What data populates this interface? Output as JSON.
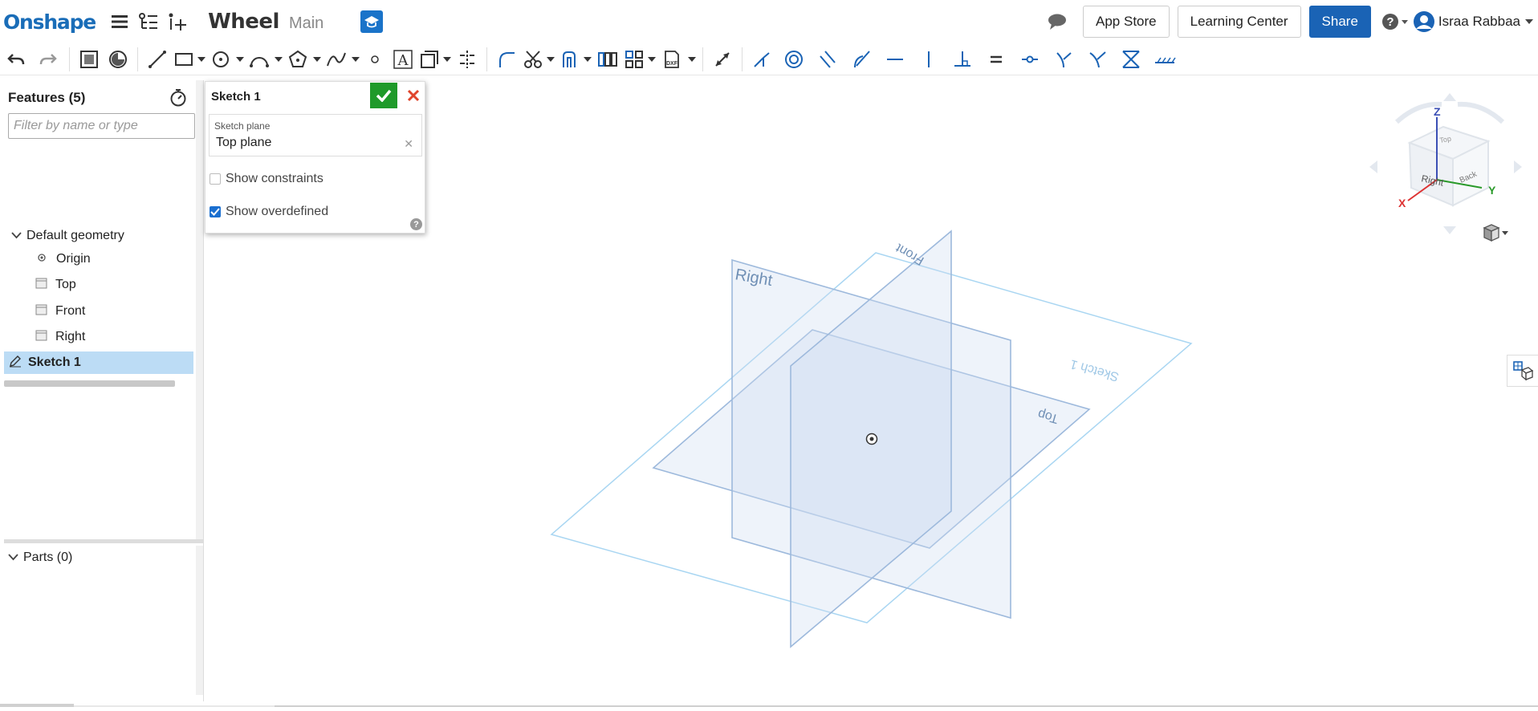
{
  "header": {
    "logo": "Onshape",
    "document_title": "Wheel",
    "branch": "Main",
    "app_store": "App Store",
    "learning_center": "Learning Center",
    "share": "Share",
    "user_name": "Israa Rabbaa"
  },
  "features_panel": {
    "title": "Features (5)",
    "filter_placeholder": "Filter by name or type",
    "default_geometry": "Default geometry",
    "items": [
      {
        "label": "Origin",
        "icon": "origin-icon"
      },
      {
        "label": "Top",
        "icon": "plane-icon"
      },
      {
        "label": "Front",
        "icon": "plane-icon"
      },
      {
        "label": "Right",
        "icon": "plane-icon"
      }
    ],
    "selected_feature": "Sketch 1",
    "parts": "Parts (0)"
  },
  "sketch_dialog": {
    "title": "Sketch 1",
    "plane_label": "Sketch plane",
    "plane_value": "Top plane",
    "show_constraints": "Show constraints",
    "show_constraints_checked": false,
    "show_overdefined": "Show overdefined",
    "show_overdefined_checked": true
  },
  "viewport": {
    "plane_labels": {
      "right": "Right",
      "front": "Front",
      "top": "Top",
      "sketch": "Sketch 1"
    },
    "view_cube": {
      "z": "Z",
      "x": "X",
      "y": "Y",
      "right": "Right",
      "back": "Back",
      "top": "Top"
    },
    "plane_color": "#8fb3d9",
    "sketch_plane_color": "#9fd0ef"
  },
  "colors": {
    "brand": "#1a6db8",
    "accept": "#1f9a2a",
    "cancel": "#e0452c",
    "selection": "#bcdcf5"
  }
}
